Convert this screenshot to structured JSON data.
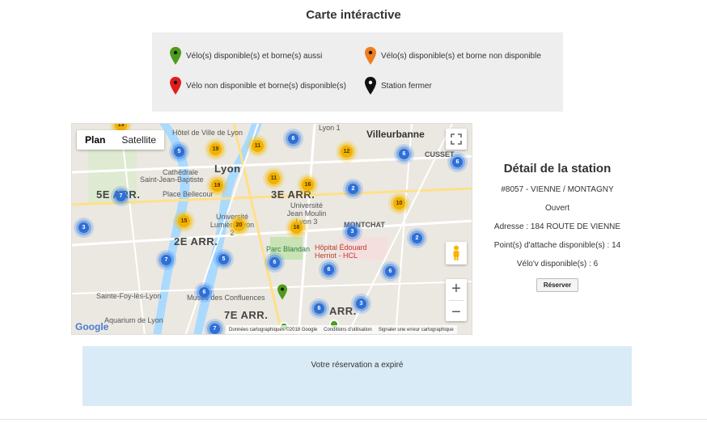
{
  "page": {
    "title": "Carte intéractive"
  },
  "legend": {
    "items": [
      {
        "label": "Vélo(s) disponible(s) et borne(s) aussi",
        "color": "#4c9b1a",
        "icon": "green-marker-icon"
      },
      {
        "label": "Vélo(s) disponible(s) et borne non disponible",
        "color": "#f07c1e",
        "icon": "orange-marker-icon"
      },
      {
        "label": "Vélo non disponible et borne(s) disponible(s)",
        "color": "#e31c1c",
        "icon": "red-marker-icon"
      },
      {
        "label": "Station fermer",
        "color": "#111111",
        "icon": "black-marker-icon"
      }
    ]
  },
  "map": {
    "map_type_buttons": [
      "Plan",
      "Satellite"
    ],
    "active_map_type": "Plan",
    "labels": {
      "villeurbanne": "Villeurbanne",
      "lyon": "Lyon",
      "hotel_de_ville": "Hôtel de Ville de Lyon",
      "cathedrale": "Cathédrale",
      "saint_jean": "Saint-Jean-Baptiste",
      "place_bellecour": "Place Bellecour",
      "arr_5e": "5E ARR.",
      "arr_3e": "3E ARR.",
      "arr_2e": "2E ARR.",
      "arr_7e": "7E ARR.",
      "arr_short": "ARR.",
      "montchat": "MONTCHAT",
      "cusset": "CUSSET",
      "universite_lumiere": "Université Lumière Lyon 2",
      "universite_jean_moulin": "Université Jean Moulin Lyon 3",
      "parc_blandan": "Parc Blandan",
      "hopital": "Hôpital Édouard Herriot - HCL",
      "sainte_foy": "Sainte-Foy-lès-Lyon",
      "musee": "Musée des Confluences",
      "aquarium": "Aquarium de Lyon",
      "lyon1": "Lyon 1"
    },
    "clusters": [
      {
        "count": "13",
        "kind": "yellow"
      },
      {
        "count": "5",
        "kind": "blue"
      },
      {
        "count": "19",
        "kind": "yellow"
      },
      {
        "count": "11",
        "kind": "yellow"
      },
      {
        "count": "6",
        "kind": "blue"
      },
      {
        "count": "12",
        "kind": "yellow"
      },
      {
        "count": "6",
        "kind": "blue"
      },
      {
        "count": "6",
        "kind": "blue"
      },
      {
        "count": "7",
        "kind": "blue"
      },
      {
        "count": "19",
        "kind": "yellow"
      },
      {
        "count": "11",
        "kind": "yellow"
      },
      {
        "count": "16",
        "kind": "yellow"
      },
      {
        "count": "2",
        "kind": "blue"
      },
      {
        "count": "10",
        "kind": "yellow"
      },
      {
        "count": "3",
        "kind": "blue"
      },
      {
        "count": "15",
        "kind": "yellow"
      },
      {
        "count": "20",
        "kind": "yellow"
      },
      {
        "count": "16",
        "kind": "yellow"
      },
      {
        "count": "3",
        "kind": "blue"
      },
      {
        "count": "2",
        "kind": "blue"
      },
      {
        "count": "7",
        "kind": "blue"
      },
      {
        "count": "5",
        "kind": "blue"
      },
      {
        "count": "6",
        "kind": "blue"
      },
      {
        "count": "6",
        "kind": "blue"
      },
      {
        "count": "6",
        "kind": "blue"
      },
      {
        "count": "6",
        "kind": "blue"
      },
      {
        "count": "6",
        "kind": "blue"
      },
      {
        "count": "3",
        "kind": "blue"
      },
      {
        "count": "7",
        "kind": "blue"
      }
    ],
    "attribution": {
      "data": "Données cartographiques ©2018 Google",
      "terms": "Conditions d'utilisation",
      "report": "Signaler une erreur cartographique"
    },
    "google_logo": "Google"
  },
  "detail": {
    "title": "Détail de la station",
    "station": "#8057 - VIENNE / MONTAGNY",
    "status": "Ouvert",
    "address": "Adresse : 184 ROUTE DE VIENNE",
    "attach_points": "Point(s) d'attache disponible(s) : 14",
    "bikes": "Vélo'v disponible(s) : 6",
    "reserve_label": "Réserver"
  },
  "alert": {
    "message": "Votre réservation a expiré"
  }
}
